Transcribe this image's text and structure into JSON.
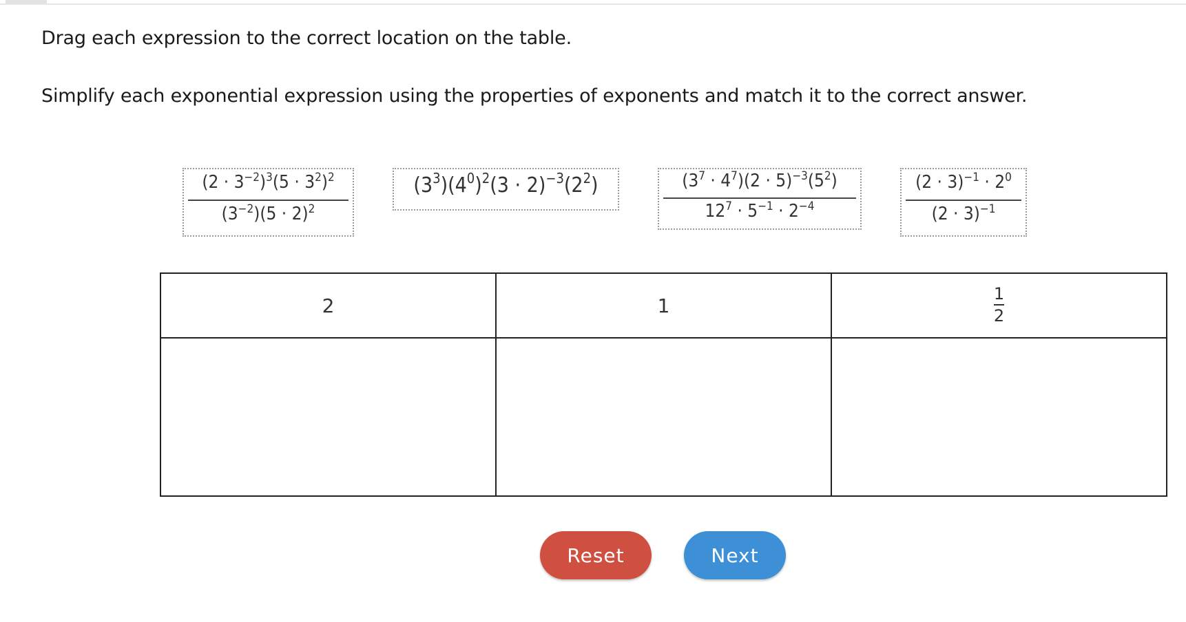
{
  "instructions": {
    "line1": "Drag each expression to the correct location on the table.",
    "line2": "Simplify each exponential expression using the properties of exponents and match it to the correct answer."
  },
  "table_headers": [
    "2",
    "1",
    "1/2"
  ],
  "half_fraction": {
    "numerator": "1",
    "denominator": "2"
  },
  "buttons": {
    "reset": "Reset",
    "next": "Next"
  },
  "colors": {
    "reset": "#cf5040",
    "next": "#3d8fd6",
    "table_border": "#222222"
  }
}
